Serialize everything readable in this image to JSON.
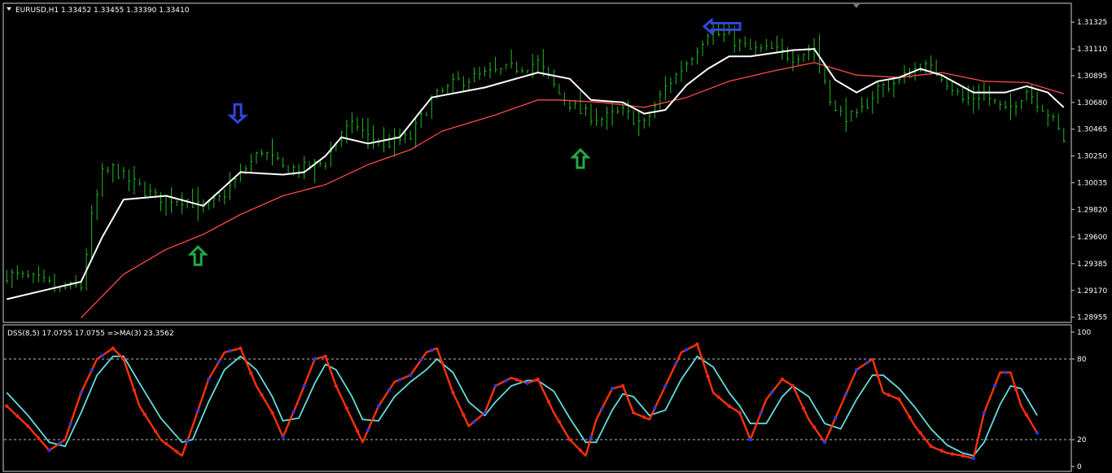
{
  "chart_data": [
    {
      "type": "line",
      "title": "EURUSD,H1  1.33452 1.33455 1.33390 1.33410",
      "symbol": "EURUSD,H1",
      "ohlc": [
        "1.33452",
        "1.33455",
        "1.33390",
        "1.33410"
      ],
      "bar_style": "HLC bars",
      "yticks": [
        "1.31325",
        "1.31110",
        "1.30895",
        "1.30680",
        "1.30465",
        "1.30250",
        "1.30035",
        "1.29820",
        "1.29600",
        "1.29385",
        "1.29170",
        "1.28955"
      ],
      "ylim": [
        1.2892,
        1.3147
      ],
      "x_count": 200,
      "series": [
        {
          "role": "price",
          "color": "#22bb22",
          "points": [
            [
              0,
              1.293
            ],
            [
              6,
              1.2925
            ],
            [
              10,
              1.2918
            ],
            [
              14,
              1.292
            ],
            [
              16,
              1.2975
            ],
            [
              18,
              1.301
            ],
            [
              20,
              1.3015
            ],
            [
              22,
              1.3008
            ],
            [
              28,
              1.2992
            ],
            [
              34,
              1.299
            ],
            [
              37,
              1.2982
            ],
            [
              40,
              1.299
            ],
            [
              44,
              1.301
            ],
            [
              48,
              1.303
            ],
            [
              52,
              1.3015
            ],
            [
              56,
              1.3015
            ],
            [
              60,
              1.302
            ],
            [
              63,
              1.3045
            ],
            [
              66,
              1.305
            ],
            [
              68,
              1.304
            ],
            [
              72,
              1.3035
            ],
            [
              76,
              1.304
            ],
            [
              80,
              1.307
            ],
            [
              85,
              1.3085
            ],
            [
              90,
              1.309
            ],
            [
              95,
              1.3095
            ],
            [
              100,
              1.31
            ],
            [
              104,
              1.3075
            ],
            [
              108,
              1.306
            ],
            [
              112,
              1.3055
            ],
            [
              116,
              1.306
            ],
            [
              120,
              1.305
            ],
            [
              124,
              1.308
            ],
            [
              128,
              1.31
            ],
            [
              132,
              1.3125
            ],
            [
              136,
              1.312
            ],
            [
              140,
              1.311
            ],
            [
              144,
              1.311
            ],
            [
              148,
              1.3105
            ],
            [
              152,
              1.3112
            ],
            [
              156,
              1.306
            ],
            [
              160,
              1.3055
            ],
            [
              164,
              1.308
            ],
            [
              168,
              1.3085
            ],
            [
              172,
              1.3098
            ],
            [
              176,
              1.309
            ],
            [
              180,
              1.307
            ],
            [
              184,
              1.3075
            ],
            [
              188,
              1.306
            ],
            [
              192,
              1.3078
            ],
            [
              196,
              1.306
            ],
            [
              199,
              1.3038
            ]
          ]
        },
        {
          "role": "fast MA",
          "color": "#ffffff",
          "points": [
            [
              0,
              1.291
            ],
            [
              8,
              1.2918
            ],
            [
              14,
              1.2924
            ],
            [
              18,
              1.296
            ],
            [
              22,
              1.299
            ],
            [
              30,
              1.2993
            ],
            [
              37,
              1.2985
            ],
            [
              44,
              1.3012
            ],
            [
              52,
              1.301
            ],
            [
              56,
              1.3012
            ],
            [
              60,
              1.3025
            ],
            [
              63,
              1.304
            ],
            [
              68,
              1.3035
            ],
            [
              74,
              1.304
            ],
            [
              80,
              1.3072
            ],
            [
              90,
              1.308
            ],
            [
              100,
              1.3092
            ],
            [
              106,
              1.3087
            ],
            [
              110,
              1.307
            ],
            [
              116,
              1.3068
            ],
            [
              120,
              1.3059
            ],
            [
              124,
              1.3062
            ],
            [
              128,
              1.3082
            ],
            [
              132,
              1.3095
            ],
            [
              136,
              1.3105
            ],
            [
              140,
              1.3105
            ],
            [
              148,
              1.311
            ],
            [
              152,
              1.3111
            ],
            [
              156,
              1.3086
            ],
            [
              160,
              1.3076
            ],
            [
              164,
              1.3085
            ],
            [
              168,
              1.3088
            ],
            [
              172,
              1.3095
            ],
            [
              176,
              1.309
            ],
            [
              182,
              1.3076
            ],
            [
              188,
              1.3076
            ],
            [
              192,
              1.3081
            ],
            [
              196,
              1.3076
            ],
            [
              199,
              1.3064
            ]
          ]
        },
        {
          "role": "slow MA",
          "color": "#ff4a4a",
          "points": [
            [
              14,
              1.2895
            ],
            [
              22,
              1.293
            ],
            [
              30,
              1.295
            ],
            [
              37,
              1.2962
            ],
            [
              44,
              1.2978
            ],
            [
              52,
              1.2993
            ],
            [
              60,
              1.3002
            ],
            [
              68,
              1.3018
            ],
            [
              76,
              1.303
            ],
            [
              82,
              1.3045
            ],
            [
              92,
              1.3058
            ],
            [
              100,
              1.307
            ],
            [
              104,
              1.307
            ],
            [
              112,
              1.3068
            ],
            [
              120,
              1.3064
            ],
            [
              128,
              1.3072
            ],
            [
              136,
              1.3085
            ],
            [
              144,
              1.3093
            ],
            [
              152,
              1.31
            ],
            [
              160,
              1.309
            ],
            [
              168,
              1.3088
            ],
            [
              176,
              1.3092
            ],
            [
              184,
              1.3085
            ],
            [
              192,
              1.3084
            ],
            [
              199,
              1.3075
            ]
          ]
        }
      ],
      "annotations": [
        {
          "shape": "arrow-down",
          "color": "#3344dd",
          "x": 43.5,
          "y": 1.3052
        },
        {
          "shape": "arrow-up",
          "color": "#22aa44",
          "x": 36,
          "y": 1.2952
        },
        {
          "shape": "arrow-up",
          "color": "#22aa44",
          "x": 108,
          "y": 1.303
        },
        {
          "shape": "arrow-left",
          "color": "#3344dd",
          "x": 133,
          "y": 1.3129
        }
      ]
    },
    {
      "type": "line",
      "title": "DSS(8,5) 17.0755 17.0755  =>MA(3) 23.3562",
      "yticks": [
        "100",
        "80",
        "20",
        "0"
      ],
      "ylim": [
        0,
        100
      ],
      "levels": [
        80,
        20
      ],
      "x_count": 200,
      "series": [
        {
          "role": "DSS",
          "color": "#ff3300",
          "dot_up": "#1a3cff",
          "dot_down": "#ff2222",
          "points": [
            [
              0,
              45
            ],
            [
              4,
              30
            ],
            [
              8,
              12
            ],
            [
              11,
              20
            ],
            [
              14,
              55
            ],
            [
              17,
              80
            ],
            [
              20,
              88
            ],
            [
              22,
              80
            ],
            [
              25,
              45
            ],
            [
              29,
              20
            ],
            [
              33,
              8
            ],
            [
              35,
              30
            ],
            [
              38,
              65
            ],
            [
              41,
              85
            ],
            [
              44,
              88
            ],
            [
              47,
              60
            ],
            [
              50,
              40
            ],
            [
              52,
              22
            ],
            [
              55,
              50
            ],
            [
              58,
              80
            ],
            [
              60,
              82
            ],
            [
              62,
              60
            ],
            [
              65,
              35
            ],
            [
              67,
              18
            ],
            [
              70,
              45
            ],
            [
              73,
              63
            ],
            [
              76,
              68
            ],
            [
              79,
              85
            ],
            [
              81,
              88
            ],
            [
              84,
              55
            ],
            [
              87,
              30
            ],
            [
              90,
              40
            ],
            [
              92,
              60
            ],
            [
              95,
              66
            ],
            [
              98,
              62
            ],
            [
              100,
              65
            ],
            [
              103,
              40
            ],
            [
              106,
              20
            ],
            [
              109,
              8
            ],
            [
              111,
              35
            ],
            [
              114,
              58
            ],
            [
              116,
              60
            ],
            [
              118,
              40
            ],
            [
              121,
              35
            ],
            [
              124,
              60
            ],
            [
              127,
              85
            ],
            [
              130,
              91
            ],
            [
              133,
              55
            ],
            [
              136,
              45
            ],
            [
              138,
              40
            ],
            [
              140,
              20
            ],
            [
              143,
              50
            ],
            [
              146,
              65
            ],
            [
              148,
              60
            ],
            [
              151,
              35
            ],
            [
              154,
              18
            ],
            [
              157,
              45
            ],
            [
              160,
              72
            ],
            [
              163,
              80
            ],
            [
              165,
              55
            ],
            [
              168,
              50
            ],
            [
              171,
              30
            ],
            [
              174,
              15
            ],
            [
              177,
              10
            ],
            [
              180,
              8
            ],
            [
              182,
              6
            ],
            [
              184,
              40
            ],
            [
              187,
              70
            ],
            [
              189,
              70
            ],
            [
              191,
              45
            ],
            [
              194,
              25
            ]
          ]
        },
        {
          "role": "MA(3)",
          "color": "#66dddd",
          "points": [
            [
              0,
              55
            ],
            [
              4,
              38
            ],
            [
              8,
              18
            ],
            [
              11,
              15
            ],
            [
              14,
              40
            ],
            [
              17,
              68
            ],
            [
              20,
              82
            ],
            [
              22,
              82
            ],
            [
              25,
              62
            ],
            [
              29,
              36
            ],
            [
              33,
              18
            ],
            [
              35,
              20
            ],
            [
              38,
              48
            ],
            [
              41,
              72
            ],
            [
              44,
              82
            ],
            [
              47,
              72
            ],
            [
              50,
              52
            ],
            [
              52,
              34
            ],
            [
              55,
              36
            ],
            [
              58,
              62
            ],
            [
              60,
              76
            ],
            [
              62,
              72
            ],
            [
              65,
              52
            ],
            [
              67,
              35
            ],
            [
              70,
              34
            ],
            [
              73,
              52
            ],
            [
              76,
              63
            ],
            [
              79,
              72
            ],
            [
              81,
              80
            ],
            [
              84,
              70
            ],
            [
              87,
              48
            ],
            [
              90,
              38
            ],
            [
              92,
              48
            ],
            [
              95,
              60
            ],
            [
              98,
              64
            ],
            [
              100,
              64
            ],
            [
              103,
              56
            ],
            [
              106,
              36
            ],
            [
              109,
              18
            ],
            [
              111,
              18
            ],
            [
              114,
              42
            ],
            [
              116,
              54
            ],
            [
              118,
              52
            ],
            [
              121,
              38
            ],
            [
              124,
              42
            ],
            [
              127,
              65
            ],
            [
              130,
              82
            ],
            [
              133,
              74
            ],
            [
              136,
              55
            ],
            [
              138,
              45
            ],
            [
              140,
              32
            ],
            [
              143,
              32
            ],
            [
              146,
              52
            ],
            [
              148,
              60
            ],
            [
              151,
              52
            ],
            [
              154,
              32
            ],
            [
              157,
              28
            ],
            [
              160,
              50
            ],
            [
              163,
              68
            ],
            [
              165,
              68
            ],
            [
              168,
              58
            ],
            [
              171,
              44
            ],
            [
              174,
              28
            ],
            [
              177,
              16
            ],
            [
              180,
              10
            ],
            [
              182,
              8
            ],
            [
              184,
              18
            ],
            [
              187,
              46
            ],
            [
              189,
              60
            ],
            [
              191,
              58
            ],
            [
              194,
              38
            ]
          ]
        }
      ]
    }
  ]
}
